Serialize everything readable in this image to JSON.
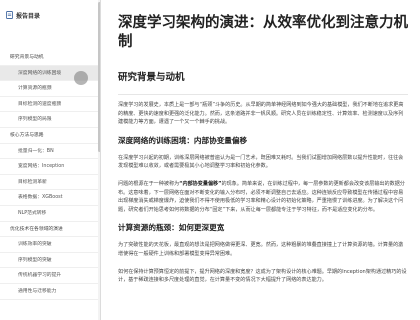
{
  "sidebar": {
    "title": "报告目录",
    "items": [
      {
        "label": "研究背景与动机",
        "level": 1
      },
      {
        "label": "深度网络的训练困境",
        "level": 2,
        "active": true
      },
      {
        "label": "计算资源的瓶颈",
        "level": 2
      },
      {
        "label": "目标检测的速度瓶颈",
        "level": 2
      },
      {
        "label": "序列模型的局限",
        "level": 2
      },
      {
        "label": "核心方法与思路",
        "level": 1
      },
      {
        "label": "批量归一化：BN",
        "level": 2
      },
      {
        "label": "宽度网络：Inception",
        "level": 2
      },
      {
        "label": "目标检测革新",
        "level": 2
      },
      {
        "label": "表格数据：XGBoost",
        "level": 2
      },
      {
        "label": "NLP范式转移",
        "level": 2
      },
      {
        "label": "优化技术在各领域的演进",
        "level": 1
      },
      {
        "label": "训练效率的突破",
        "level": 2
      },
      {
        "label": "序列模型的突破",
        "level": 2
      },
      {
        "label": "传统机器学习的提升",
        "level": 2
      },
      {
        "label": "通用性与迁移能力",
        "level": 2
      }
    ]
  },
  "main": {
    "title": "深度学习架构的演进：从效率优化到注意力机制",
    "section1": {
      "heading": "研究背景与动机",
      "intro": "深度学习的发展史，本质上是一部与“瓶颈”斗争的历史。从早期的简单神经网络到如今强大的基础模型，我们不断地在追求更高的精度、更快的速度和更强的泛化能力。然而，这条道路并非一帆风顺。研究人员在训练稳定性、计算效率、检测速度以及序列建模能力等方面，遭遇了一个又一个棘手的挑战。"
    },
    "sub1": {
      "heading": "深度网络的训练困境：内部协变量偏移",
      "p1": "在深度学习兴起的初期，训练深层网络被普遍认为是一门艺术，既困难又耗时。当我们试图增加网络层数以提升性能时，往往会发现模型难以收敛，或者需要极其小心地调整学习率和初始化参数。",
      "p2_pre": "问题的根源在于一种被称为",
      "p2_term": "“内部协变量偏移”",
      "p2_post": "的现象。简单来说，在训练过程中，每一层参数的更新都会改变该层输出的数据分布。这意味着，下一层网络在面对不断变化的输入分布时，必须不断调整自己去适应。这种连锁反应导致模型在传播过程中容易出现梯度消失或梯度爆炸，迫使我们不得不使用极低的学习率和精心设计的初始化策略，严重拖慢了训练进度。为了解决这个问题，研究者们开始思考如何将数据的分布“固定”下来，从而让每一层都能专注于学习特征，而不是适应变化的分布。"
    },
    "sub2": {
      "heading": "计算资源的瓶颈：如何更深更宽",
      "p1": "为了突破性能的天花板，最直观的想法是把网络做得更深、更宽。然而，这种粗暴的堆叠直接撞上了计算资源的墙。计算量的激增使得在一般硬件上训练和部署模型变得异常困难。",
      "p2": "如何在保持计算预算恒定的前提下，提升网络的深度和宽度？这成为了架构设计的核心难题。早期的Inception架构通过精巧的设计，基于稀疏连接和多尺度处理的直觉，在计算量不变的情况下大幅提升了网络的表达能力。"
    }
  }
}
